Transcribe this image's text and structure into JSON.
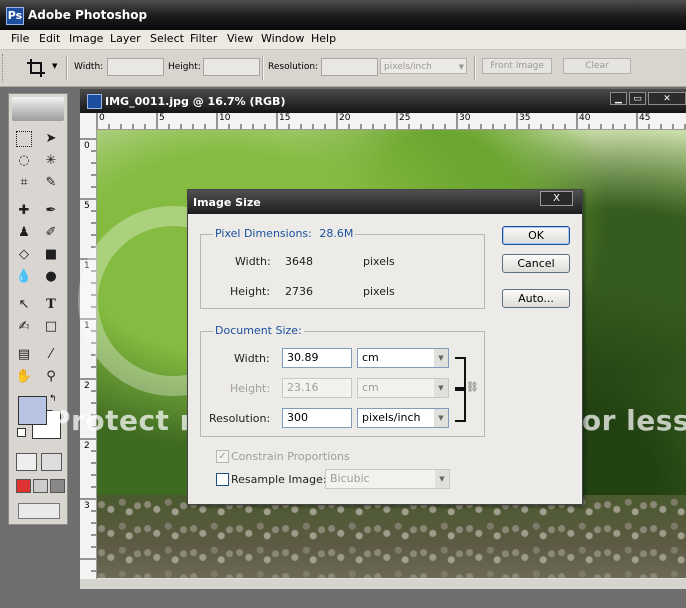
{
  "app": {
    "title": "Adobe Photoshop",
    "logo_letter": "Ps"
  },
  "menu": [
    "File",
    "Edit",
    "Image",
    "Layer",
    "Select",
    "Filter",
    "View",
    "Window",
    "Help"
  ],
  "options_bar": {
    "width_label": "Width:",
    "height_label": "Height:",
    "resolution_label": "Resolution:",
    "units_value": "pixels/inch",
    "front_image_label": "Front Image",
    "clear_label": "Clear"
  },
  "document": {
    "title": "IMG_0011.jpg @ 16.7% (RGB)",
    "ruler_top": [
      "0",
      "5",
      "10",
      "15",
      "20",
      "25",
      "30",
      "35",
      "40",
      "45"
    ],
    "ruler_left": [
      "0",
      "5",
      "1",
      "1",
      "2",
      "2",
      "3"
    ],
    "watermark": "Protect more of your memories for less!"
  },
  "dialog": {
    "title": "Image Size",
    "close_label": "X",
    "pixel_dimensions": {
      "title": "Pixel Dimensions:",
      "size": "28.6M",
      "width_label": "Width:",
      "width_value": "3648",
      "width_unit": "pixels",
      "height_label": "Height:",
      "height_value": "2736",
      "height_unit": "pixels"
    },
    "document_size": {
      "title": "Document Size:",
      "width_label": "Width:",
      "width_value": "30.89",
      "width_unit": "cm",
      "height_label": "Height:",
      "height_value": "23.16",
      "height_unit": "cm",
      "resolution_label": "Resolution:",
      "resolution_value": "300",
      "resolution_unit": "pixels/inch"
    },
    "constrain_label": "Constrain Proportions",
    "constrain_checked": "✓",
    "resample_label": "Resample Image:",
    "resample_method": "Bicubic",
    "ok_label": "OK",
    "cancel_label": "Cancel",
    "auto_label": "Auto..."
  },
  "colors": {
    "foreground": "#b8c4e4",
    "background": "#ffffff",
    "accent_blue": "#1a4f9e"
  },
  "icons": [
    "crop-icon",
    "marquee-icon",
    "move-icon",
    "lasso-icon",
    "magic-wand-icon",
    "brush-icon",
    "text-icon",
    "hand-icon",
    "zoom-icon"
  ]
}
